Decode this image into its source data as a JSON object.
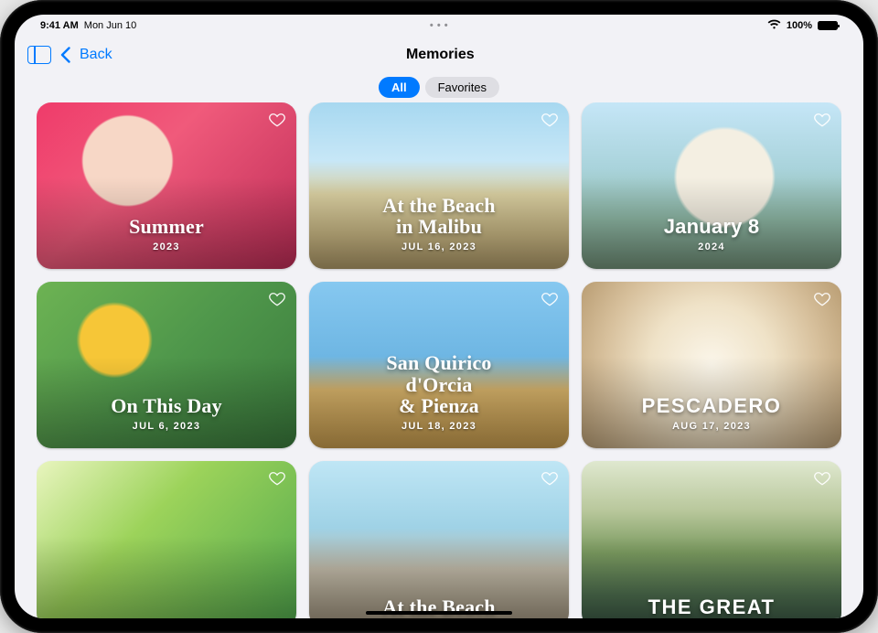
{
  "status": {
    "time": "9:41 AM",
    "date": "Mon Jun 10",
    "more_icon": "more-icon",
    "wifi_icon": "wifi-icon",
    "battery_pct": "100%"
  },
  "navbar": {
    "sidebar_icon": "sidebar-icon",
    "back_label": "Back",
    "title": "Memories"
  },
  "segments": {
    "all": "All",
    "favorites": "Favorites",
    "selected": "all"
  },
  "memories": [
    {
      "title": "Summer",
      "date": "2023",
      "style": "serif"
    },
    {
      "title": "At the Beach\nin Malibu",
      "date": "JUL 16, 2023",
      "style": "serif"
    },
    {
      "title": "January 8",
      "date": "2024",
      "style": "sans"
    },
    {
      "title": "On This Day",
      "date": "JUL 6, 2023",
      "style": "serif"
    },
    {
      "title": "San Quirico\nd'Orcia\n& Pienza",
      "date": "JUL 18, 2023",
      "style": "serif"
    },
    {
      "title": "PESCADERO",
      "date": "AUG 17, 2023",
      "style": "cond"
    },
    {
      "title": "",
      "date": "",
      "style": "sans"
    },
    {
      "title": "At the Beach",
      "date": "",
      "style": "serif"
    },
    {
      "title": "THE GREAT",
      "date": "",
      "style": "cond"
    }
  ]
}
